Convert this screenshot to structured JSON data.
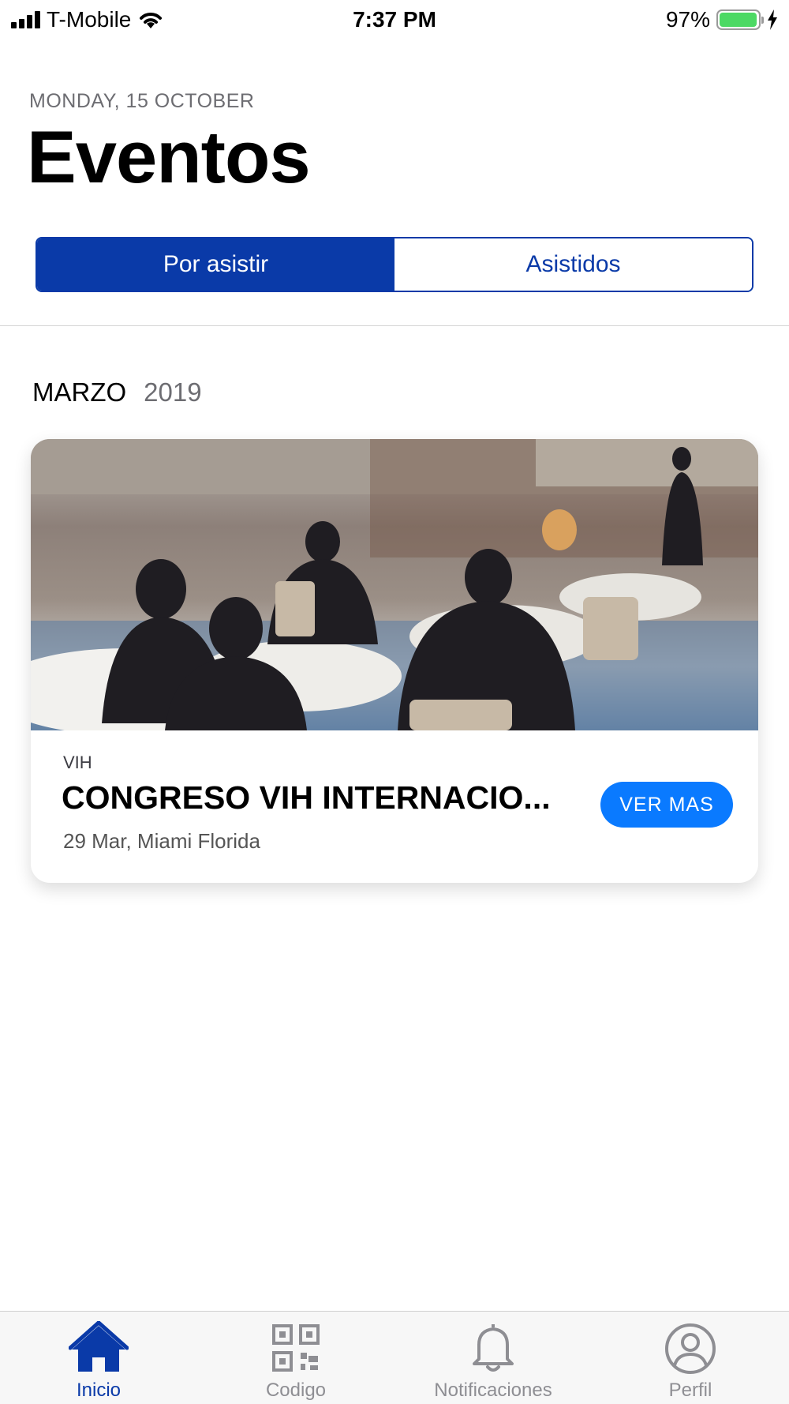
{
  "status_bar": {
    "carrier": "T-Mobile",
    "time": "7:37 PM",
    "battery": "97%",
    "battery_level": 0.97
  },
  "header": {
    "date": "MONDAY, 15 OCTOBER",
    "title": "Eventos"
  },
  "segments": [
    {
      "label": "Por asistir",
      "active": true
    },
    {
      "label": "Asistidos",
      "active": false
    }
  ],
  "section": {
    "month": "MARZO",
    "year": "2019"
  },
  "event": {
    "tag": "VIH",
    "title": "CONGRESO VIH INTERNACIO...",
    "meta": "29 Mar, Miami Florida",
    "button": "VER MAS"
  },
  "tab_bar": [
    {
      "label": "Inicio",
      "icon": "home-icon",
      "active": true
    },
    {
      "label": "Codigo",
      "icon": "qr-code-icon",
      "active": false
    },
    {
      "label": "Notificaciones",
      "icon": "bell-icon",
      "active": false
    },
    {
      "label": "Perfil",
      "icon": "profile-icon",
      "active": false
    }
  ],
  "colors": {
    "primary": "#0a3aa8",
    "button": "#0a7aff",
    "tab_inactive": "#8e8e93",
    "battery": "#4cd964"
  }
}
